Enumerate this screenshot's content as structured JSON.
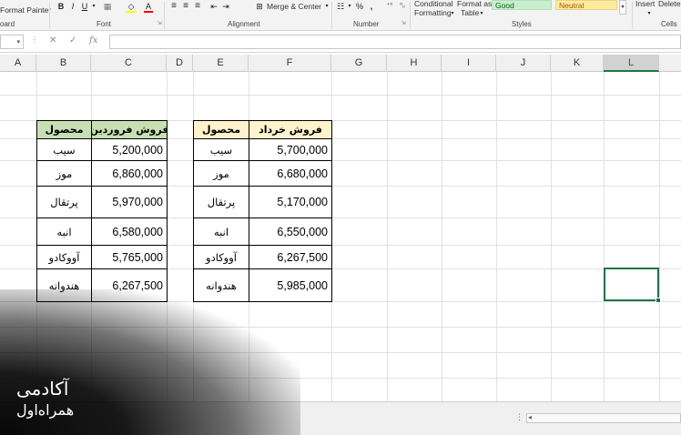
{
  "ribbon": {
    "format_painter": "Format Painter",
    "board_label": "oard",
    "font_label": "Font",
    "bold": "B",
    "italic": "I",
    "underline": "U",
    "font_color_letter": "A",
    "alignment_label": "Alignment",
    "merge_center": "Merge & Center",
    "number_label": "Number",
    "percent": "%",
    "comma": ",",
    "conditional_formatting_1": "Conditional",
    "conditional_formatting_2": "Formatting",
    "format_as_table_1": "Format as",
    "format_as_table_2": "Table",
    "styles_label": "Styles",
    "style_good": "Good",
    "style_neutral": "Neutral",
    "insert": "Insert",
    "delete": "Delete",
    "cells_label": "Cells"
  },
  "formula_bar": {
    "fx": "fx",
    "cancel": "✕",
    "enter": "✓"
  },
  "columns": [
    "A",
    "B",
    "C",
    "D",
    "E",
    "F",
    "G",
    "H",
    "I",
    "J",
    "K",
    "L"
  ],
  "selected_column": "L",
  "table1": {
    "header_product": "محصول",
    "header_sales": "فروش فروردین",
    "rows": [
      {
        "product": "سیب",
        "sales": "5,200,000"
      },
      {
        "product": "موز",
        "sales": "6,860,000"
      },
      {
        "product": "پرتقال",
        "sales": "5,970,000"
      },
      {
        "product": "انبه",
        "sales": "6,580,000"
      },
      {
        "product": "آووکادو",
        "sales": "5,765,000"
      },
      {
        "product": "هندوانه",
        "sales": "6,267,500"
      }
    ]
  },
  "table2": {
    "header_product": "محصول",
    "header_sales": "فروش خرداد",
    "rows": [
      {
        "product": "سیب",
        "sales": "5,700,000"
      },
      {
        "product": "موز",
        "sales": "6,680,000"
      },
      {
        "product": "پرتقال",
        "sales": "5,170,000"
      },
      {
        "product": "انبه",
        "sales": "6,550,000"
      },
      {
        "product": "آووکادو",
        "sales": "6,267,500"
      },
      {
        "product": "هندوانه",
        "sales": "5,985,000"
      }
    ]
  },
  "watermark": {
    "line1": "آکادمی",
    "line2": "همراه‌اول"
  },
  "colors": {
    "accent_green": "#217346",
    "header_green_fill": "#c6e0b4",
    "header_yellow_fill": "#fff2cc"
  }
}
